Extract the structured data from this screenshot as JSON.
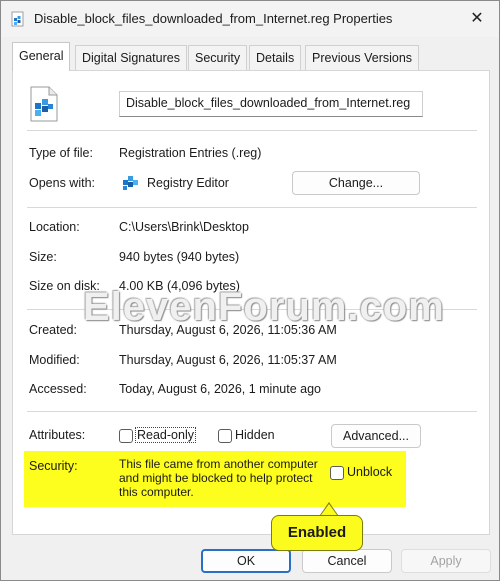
{
  "window": {
    "title": "Disable_block_files_downloaded_from_Internet.reg Properties",
    "close_glyph": "✕"
  },
  "tabs": [
    {
      "label": "General",
      "active": true
    },
    {
      "label": "Digital Signatures",
      "active": false
    },
    {
      "label": "Security",
      "active": false
    },
    {
      "label": "Details",
      "active": false
    },
    {
      "label": "Previous Versions",
      "active": false
    }
  ],
  "general": {
    "filename": "Disable_block_files_downloaded_from_Internet.reg",
    "type_of_file_label": "Type of file:",
    "type_of_file_value": "Registration Entries (.reg)",
    "opens_with_label": "Opens with:",
    "opens_with_value": "Registry Editor",
    "change_button": "Change...",
    "location_label": "Location:",
    "location_value": "C:\\Users\\Brink\\Desktop",
    "size_label": "Size:",
    "size_value": "940 bytes (940 bytes)",
    "size_on_disk_label": "Size on disk:",
    "size_on_disk_value": "4.00 KB (4,096 bytes)",
    "created_label": "Created:",
    "created_value": "Thursday, August 6, 2026, 11:05:36 AM",
    "modified_label": "Modified:",
    "modified_value": "Thursday, August 6, 2026, 11:05:37 AM",
    "accessed_label": "Accessed:",
    "accessed_value": "Today, August 6, 2026, 1 minute ago",
    "attributes_label": "Attributes:",
    "read_only_label": "Read-only",
    "hidden_label": "Hidden",
    "advanced_button": "Advanced...",
    "security_label": "Security:",
    "security_message": "This file came from another computer and might be blocked to help protect this computer.",
    "unblock_label": "Unblock",
    "read_only_checked": false,
    "hidden_checked": false,
    "unblock_checked": false
  },
  "callout": "Enabled",
  "watermark": "ElevenForum.com",
  "footer": {
    "ok": "OK",
    "cancel": "Cancel",
    "apply": "Apply"
  },
  "colors": {
    "highlight": "#fdfd1e",
    "ok_border": "#2a6fc6"
  }
}
